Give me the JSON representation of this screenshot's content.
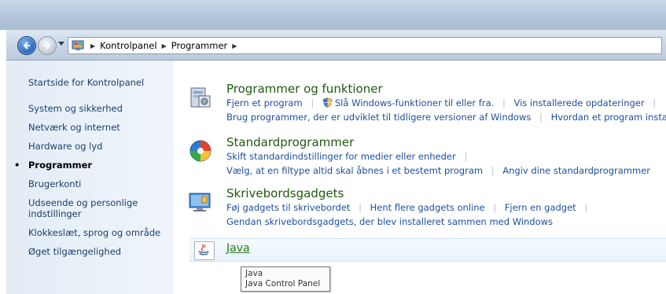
{
  "address_bar": {
    "crumbs": [
      "Kontrolpanel",
      "Programmer"
    ]
  },
  "sidebar": {
    "home": "Startside for Kontrolpanel",
    "items": [
      {
        "label": "System og sikkerhed"
      },
      {
        "label": "Netværk og internet"
      },
      {
        "label": "Hardware og lyd"
      },
      {
        "label": "Programmer",
        "current": true
      },
      {
        "label": "Brugerkonti"
      },
      {
        "label": "Udseende og personlige indstillinger"
      },
      {
        "label": "Klokkeslæt, sprog og område"
      },
      {
        "label": "Øget tilgængelighed"
      }
    ]
  },
  "categories": [
    {
      "title": "Programmer og funktioner",
      "icon": "programs-features-icon",
      "lines": [
        [
          "Fjern et program",
          "Slå Windows-funktioner til eller fra.",
          "Vis installerede opdateringer"
        ],
        [
          "Brug programmer, der er udviklet til tidligere versioner af Windows",
          "Hvordan et program installeres"
        ]
      ]
    },
    {
      "title": "Standardprogrammer",
      "icon": "default-programs-icon",
      "lines": [
        [
          "Skift standardindstillinger for medier eller enheder"
        ],
        [
          "Vælg, at en filtype altid skal åbnes i et bestemt program",
          "Angiv dine standardprogrammer"
        ]
      ]
    },
    {
      "title": "Skrivebordsgadgets",
      "icon": "desktop-gadgets-icon",
      "lines": [
        [
          "Føj gadgets til skrivebordet",
          "Hent flere gadgets online",
          "Fjern en gadget"
        ],
        [
          "Gendan skrivebordsgadgets, der blev installeret sammen med Windows"
        ]
      ]
    }
  ],
  "java": {
    "label": "Java",
    "icon": "java-icon"
  },
  "tooltip": {
    "line1": "Java",
    "line2": "Java Control Panel"
  },
  "colors": {
    "link": "#1c4f9c",
    "category_title": "#1e5a0f",
    "sidebar_bg": "#e3ecf6"
  }
}
